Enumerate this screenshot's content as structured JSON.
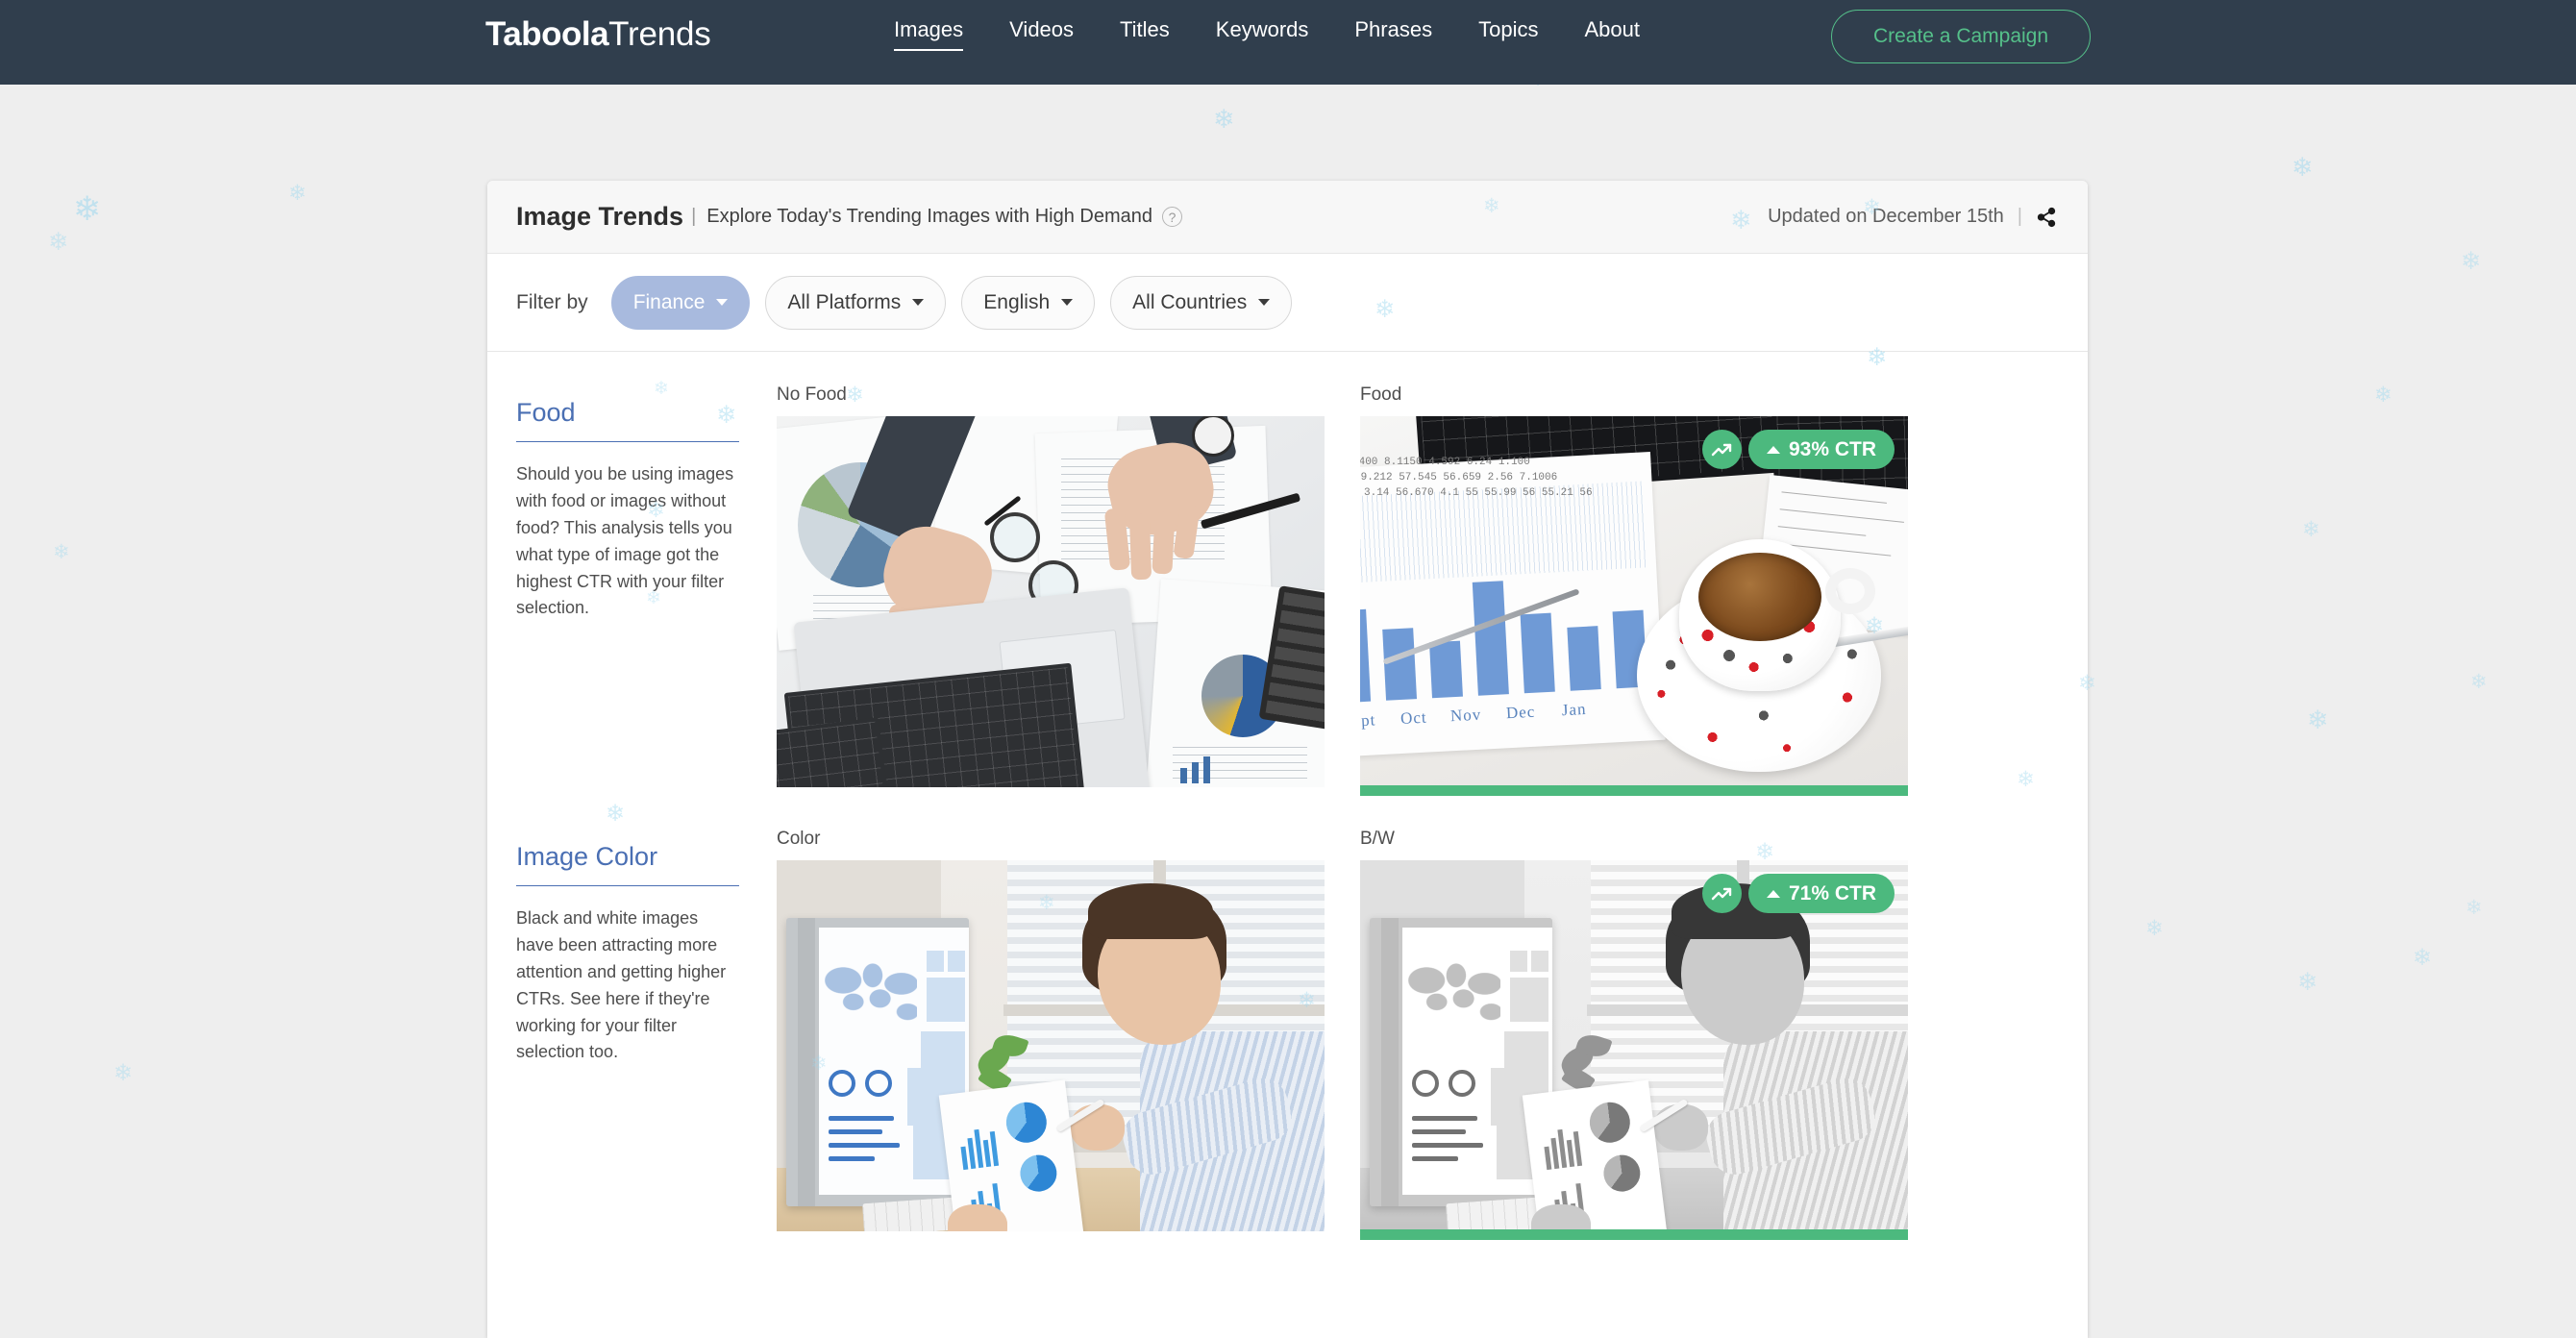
{
  "nav": {
    "logo_bold": "Tab",
    "logo_oo": "oo",
    "logo_bold2": "la",
    "logo_light": "Trends",
    "links": [
      {
        "label": "Images",
        "active": true
      },
      {
        "label": "Videos",
        "active": false
      },
      {
        "label": "Titles",
        "active": false
      },
      {
        "label": "Keywords",
        "active": false
      },
      {
        "label": "Phrases",
        "active": false
      },
      {
        "label": "Topics",
        "active": false
      },
      {
        "label": "About",
        "active": false
      }
    ],
    "cta_label": "Create a Campaign",
    "background_color": "#303e4d",
    "cta_color": "#55c08a"
  },
  "card": {
    "title": "Image Trends",
    "separator": "|",
    "subtitle": "Explore Today's Trending Images with High Demand",
    "help_icon_label": "?",
    "updated_text": "Updated on December 15th",
    "header_divider": "|",
    "share_icon": "share-icon"
  },
  "filters": {
    "label": "Filter by",
    "items": [
      {
        "value": "Finance",
        "primary": true
      },
      {
        "value": "All Platforms",
        "primary": false
      },
      {
        "value": "English",
        "primary": false
      },
      {
        "value": "All Countries",
        "primary": false
      }
    ],
    "primary_color": "#a8bade"
  },
  "sections": [
    {
      "heading": "Food",
      "description": "Should you be using images with food or images without food? This analysis tells you what type of image got the highest CTR with your filter selection.",
      "items": [
        {
          "label": "No Food",
          "winner": false,
          "badge": null,
          "artwork": "desk-flatlay-laptop-charts"
        },
        {
          "label": "Food",
          "winner": true,
          "badge": {
            "arrow": "up",
            "value": "93% CTR",
            "trend_icon": "trending-up-icon",
            "color": "#4cb97e"
          },
          "artwork": "coffee-cup-on-bar-chart"
        }
      ]
    },
    {
      "heading": "Image Color",
      "description": "Black and white images have been attracting more attention and getting higher CTRs. See here if they're working for your filter selection too.",
      "items": [
        {
          "label": "Color",
          "winner": false,
          "badge": null,
          "artwork": "man-analyzing-dashboard-color"
        },
        {
          "label": "B/W",
          "winner": true,
          "badge": {
            "arrow": "up",
            "value": "71% CTR",
            "trend_icon": "trending-up-icon",
            "color": "#4cb97e"
          },
          "artwork": "man-analyzing-dashboard-bw"
        }
      ]
    }
  ],
  "theme": {
    "page_background": "#eeeeee",
    "card_background": "#ffffff",
    "heading_color": "#4a6fb3",
    "winner_bar_color": "#4cb97e",
    "snowflake_color": "#9dd8ef"
  },
  "chart_in_image": {
    "bar_chart_months": [
      "Sept",
      "Oct",
      "Nov",
      "Dec",
      "Jan"
    ]
  }
}
